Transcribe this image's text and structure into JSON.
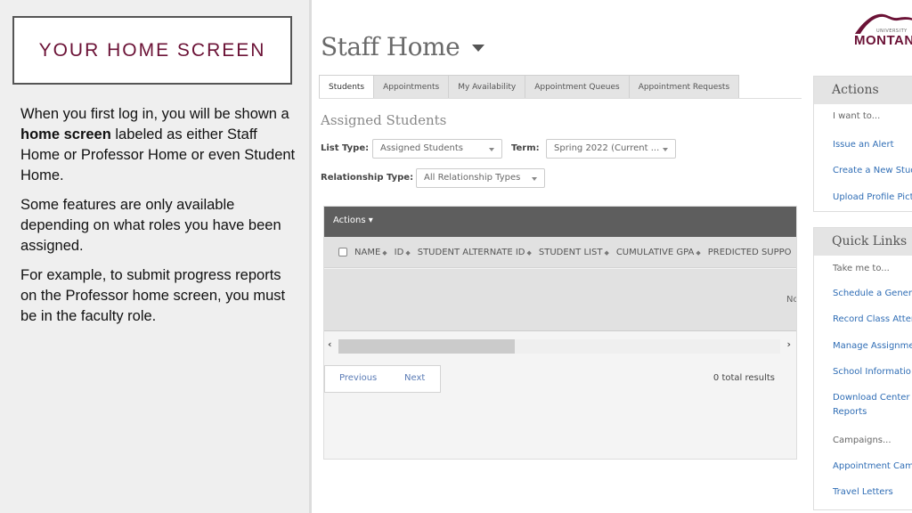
{
  "slide": {
    "title": "YOUR HOME SCREEN",
    "paragraph1_pre": "When you first log in, you will be shown a ",
    "paragraph1_bold": "home screen",
    "paragraph1_post": " labeled as either Staff Home or Professor Home or even Student Home.",
    "paragraph2": "Some features are only available depending on what roles you have been assigned.",
    "paragraph3": "For example, to submit progress reports on the Professor home screen, you must be in the faculty role."
  },
  "app": {
    "page_title": "Staff Home",
    "tabs": [
      {
        "label": "Students",
        "active": true
      },
      {
        "label": "Appointments",
        "active": false
      },
      {
        "label": "My Availability",
        "active": false
      },
      {
        "label": "Appointment Queues",
        "active": false
      },
      {
        "label": "Appointment Requests",
        "active": false
      }
    ],
    "section_title": "Assigned Students",
    "filters": {
      "list_type_label": "List Type:",
      "list_type_value": "Assigned Students",
      "term_label": "Term:",
      "term_value": "Spring 2022 (Current ...",
      "relationship_label": "Relationship Type:",
      "relationship_value": "All Relationship Types"
    },
    "grid": {
      "actions_label": "Actions ▾",
      "columns": [
        "NAME",
        "ID",
        "STUDENT ALTERNATE ID",
        "STUDENT LIST",
        "CUMULATIVE GPA",
        "PREDICTED SUPPO"
      ],
      "sort_glyph": "◆",
      "empty_text": "No",
      "scroll_thumb_fraction": 0.4,
      "prev_label": "Previous",
      "next_label": "Next",
      "total_results": "0 total results"
    },
    "logo": {
      "small_text": "UNIVERSITY",
      "word": "MONTAN",
      "color": "#6b1236"
    },
    "actions_panel": {
      "title": "Actions",
      "intro": "I want to...",
      "links": [
        "Issue an Alert",
        "Create a New Stud",
        "Upload Profile Pict"
      ]
    },
    "quick_links_panel": {
      "title": "Quick Links",
      "intro": "Take me to...",
      "links": [
        "Schedule a Genera",
        "Record Class Atter",
        "Manage Assignme",
        "School Informatio",
        "Download Center f",
        "Reports"
      ],
      "campaigns_label": "Campaigns...",
      "campaign_links": [
        "Appointment Cam",
        "Travel Letters"
      ]
    }
  },
  "colors": {
    "brand": "#6b1236",
    "link": "#2f6db5",
    "toolbar": "#5e5e5e"
  }
}
